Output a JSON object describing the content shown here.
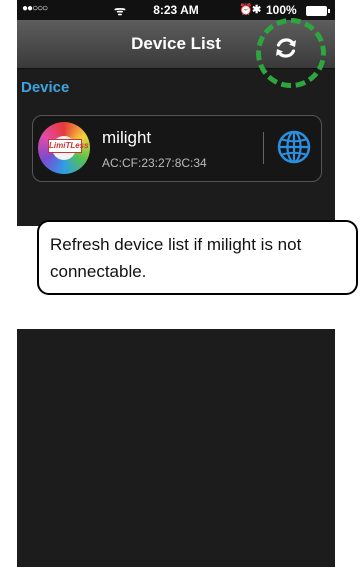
{
  "status_bar": {
    "signal": "●●○○○",
    "wifi_icon": "wifi-icon",
    "time": "8:23 AM",
    "alarm_icon": "alarm-icon",
    "bluetooth_icon": "bluetooth-icon",
    "battery": "100%"
  },
  "navbar": {
    "title": "Device List",
    "refresh_icon": "refresh-icon"
  },
  "section": {
    "title": "Device"
  },
  "devices": [
    {
      "name": "milight",
      "mac": "AC:CF:23:27:8C:34",
      "icon": "milight-logo-icon",
      "logo_text": "LimiTLess",
      "action_icon": "globe-icon"
    }
  ],
  "annotation": {
    "text": "Refresh device list if milight is not connectable.",
    "highlight_color": "#2ea53e"
  }
}
